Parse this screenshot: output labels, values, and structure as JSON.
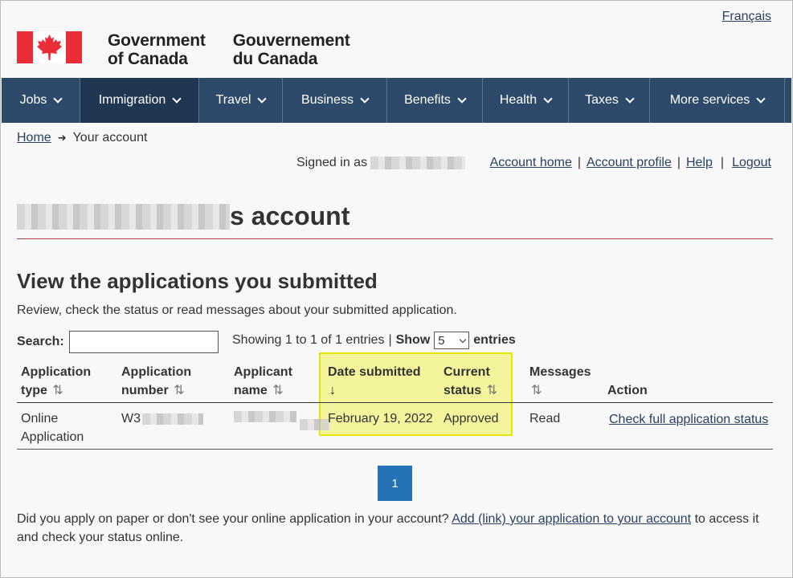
{
  "header": {
    "lang_link": "Français",
    "gov_en_line1": "Government",
    "gov_en_line2": "of Canada",
    "gov_fr_line1": "Gouvernement",
    "gov_fr_line2": "du Canada"
  },
  "menu": {
    "items": [
      {
        "label": "Jobs"
      },
      {
        "label": "Immigration"
      },
      {
        "label": "Travel"
      },
      {
        "label": "Business"
      },
      {
        "label": "Benefits"
      },
      {
        "label": "Health"
      },
      {
        "label": "Taxes"
      },
      {
        "label": "More services"
      }
    ]
  },
  "breadcrumb": {
    "home": "Home",
    "current": "Your account"
  },
  "account": {
    "signed_in_label": "Signed in as",
    "links": [
      "Account home",
      "Account profile",
      "Help",
      "Logout"
    ]
  },
  "page": {
    "title_suffix": "s account",
    "subtitle": "View the applications you submitted",
    "intro": "Review, check the status or read messages about your submitted application."
  },
  "controls": {
    "search_label": "Search:",
    "showing_text": "Showing 1 to 1 of 1 entries",
    "show_label": "Show",
    "page_size": "5",
    "entries_label": "entries"
  },
  "table": {
    "headers": {
      "type_l1": "Application",
      "type_l2": "type",
      "num_l1": "Application",
      "num_l2": "number",
      "name_l1": "Applicant",
      "name_l2": "name",
      "date_l1": "Date submitted",
      "status_l1": "Current",
      "status_l2": "status",
      "messages": "Messages",
      "action": "Action"
    },
    "row": {
      "type_l1": "Online",
      "type_l2": "Application",
      "number_prefix": "W3",
      "date": "February 19, 2022",
      "status": "Approved",
      "messages": "Read",
      "action": "Check full application status"
    }
  },
  "pager": {
    "current": "1"
  },
  "footer": {
    "text_before": "Did you apply on paper or don't see your online application in your account?",
    "link": "Add (link) your application to your account",
    "text_after": "to access it and check your status online."
  },
  "icons": {
    "sort": "⇅",
    "sort_desc": "↓",
    "breadcrumb_arrow": "➜"
  },
  "colors": {
    "menu_bg": "#2e4a6b",
    "flag_red": "#eb2d37",
    "link": "#284162",
    "pager_bg": "#2572b4",
    "highlight": "#f0f050"
  }
}
